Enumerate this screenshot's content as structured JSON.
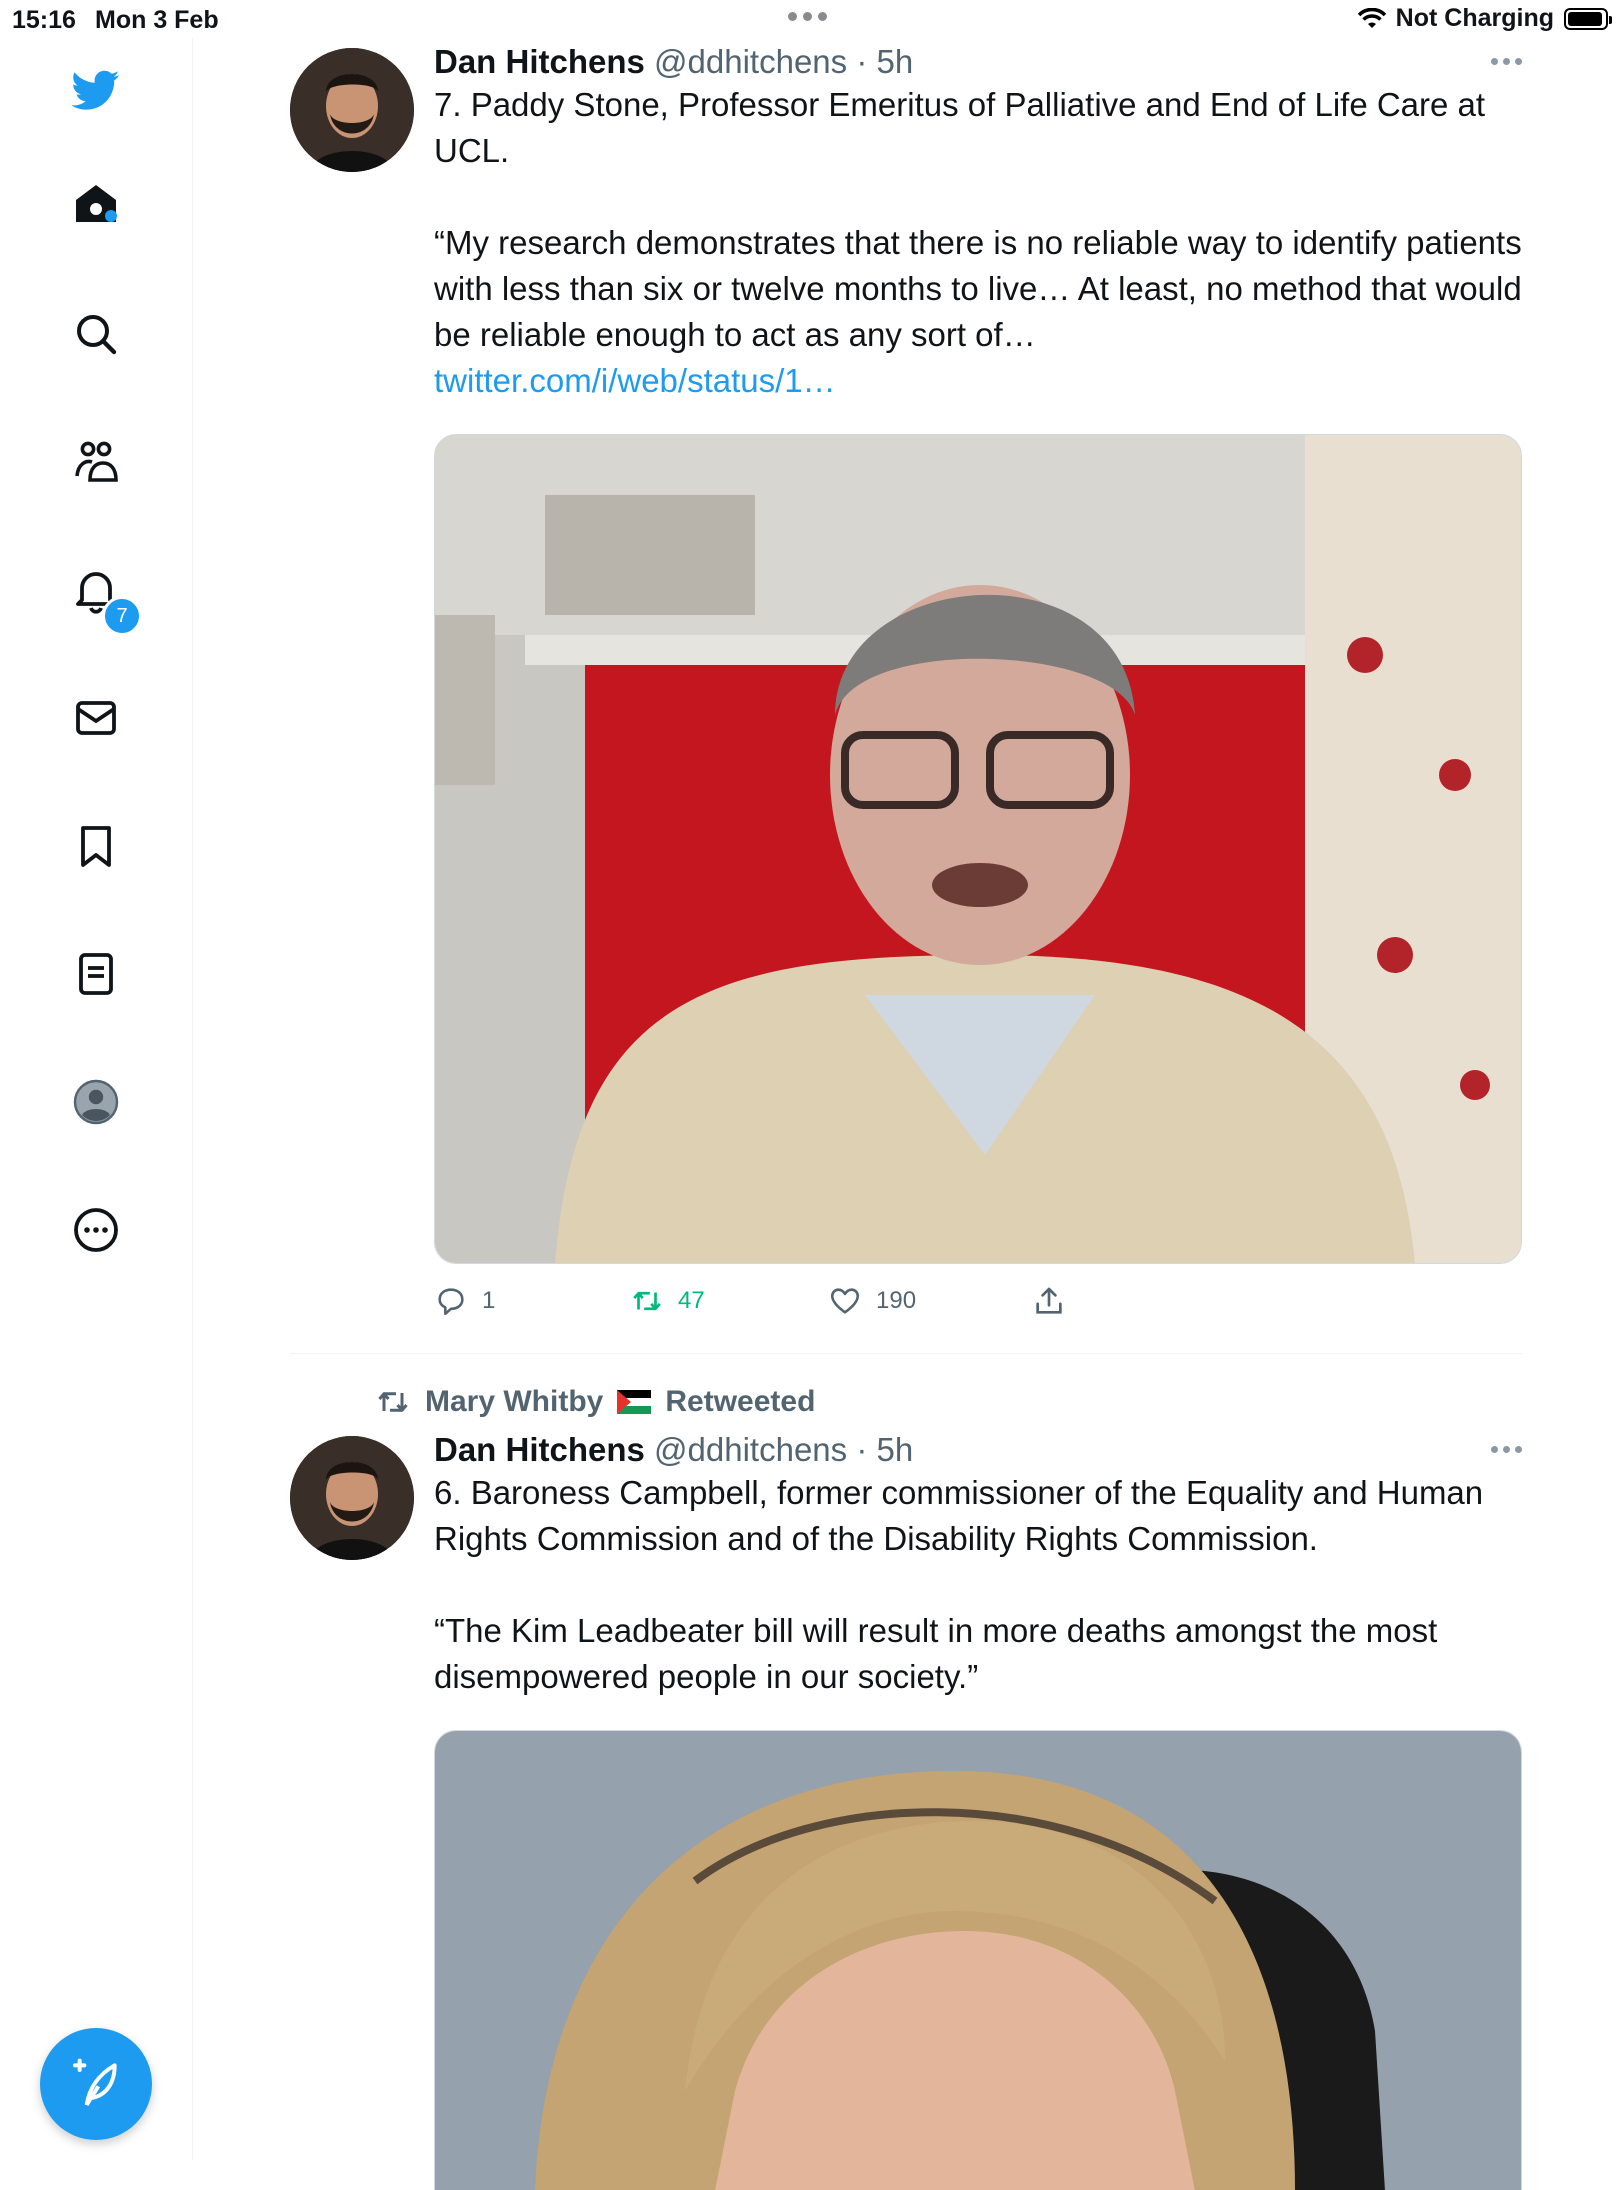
{
  "status_bar": {
    "time": "15:16",
    "date": "Mon 3 Feb",
    "charging": "Not Charging",
    "battery_level": 0.95
  },
  "sidebar": {
    "items": [
      {
        "icon": "twitter-bird-icon"
      },
      {
        "icon": "home-icon"
      },
      {
        "icon": "search-icon"
      },
      {
        "icon": "communities-icon"
      },
      {
        "icon": "notifications-icon"
      },
      {
        "icon": "messages-icon"
      },
      {
        "icon": "bookmarks-icon"
      },
      {
        "icon": "lists-icon"
      },
      {
        "icon": "profile-icon"
      },
      {
        "icon": "more-icon"
      }
    ],
    "notification_count": "7",
    "compose_icon": "compose-tweet-icon"
  },
  "tweets": [
    {
      "name": "Dan Hitchens",
      "handle": "@ddhitchens",
      "sep": " · ",
      "time": "5h",
      "text_1": "7. Paddy Stone, Professor Emeritus of Palliative and End of Life Care at UCL.",
      "text_2": "“My research demonstrates that there is no reliable way to identify patients with less than six or twelve months to live… At least, no method that would be reliable enough to act as any sort of…",
      "link": "twitter.com/i/web/status/1…",
      "replies": "1",
      "retweets": "47",
      "likes": "190"
    },
    {
      "retweeted_by": "Mary Whitby",
      "retweeted_label": "Retweeted",
      "name": "Dan Hitchens",
      "handle": "@ddhitchens",
      "sep": " · ",
      "time": "5h",
      "text_1": "6. Baroness Campbell, former commissioner of the Equality and Human Rights Commission and of the Disability Rights Commission.",
      "text_2": "“The Kim Leadbeater bill will result in more deaths amongst the most disempowered people in our society.”"
    }
  ],
  "colors": {
    "accent": "#1d9bf0",
    "retweet": "#00ba7c",
    "secondary_text": "#536471"
  }
}
